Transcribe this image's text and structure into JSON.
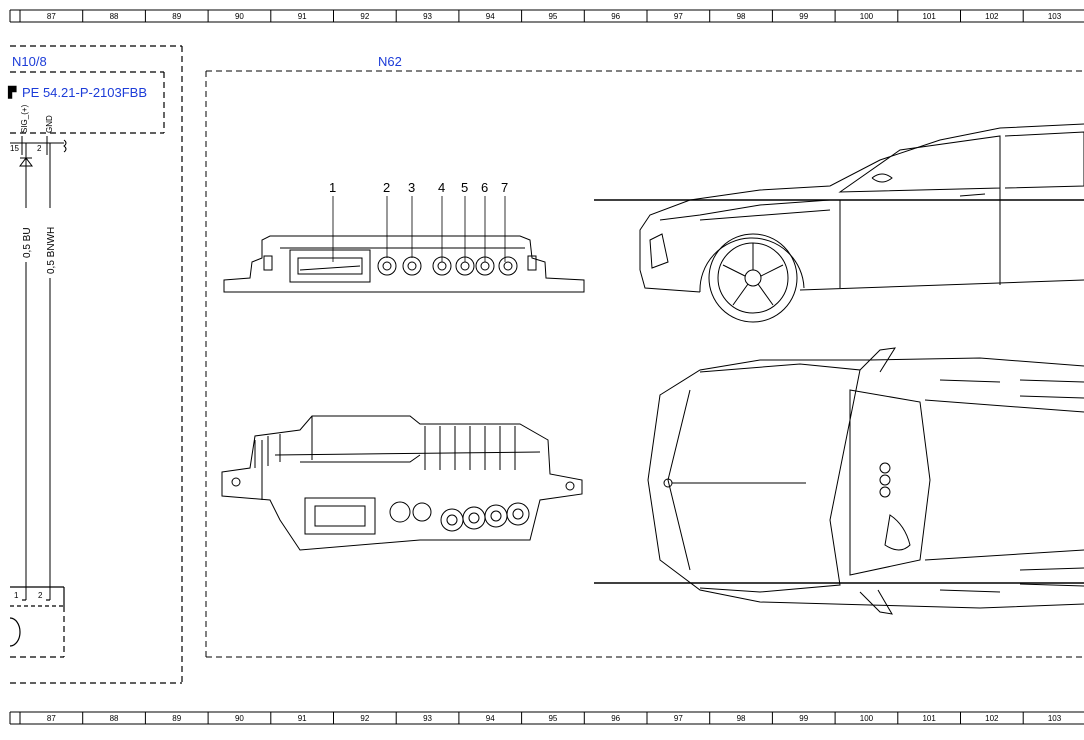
{
  "ruler": {
    "numbers": [
      "87",
      "88",
      "89",
      "90",
      "91",
      "92",
      "93",
      "94",
      "95",
      "96",
      "97",
      "98",
      "99",
      "100",
      "101",
      "102",
      "103"
    ]
  },
  "n10": {
    "label": "N10/8",
    "ref": "PE 54.21-P-2103FBB",
    "pin1_signal": "SIG_(+)",
    "pin2_signal": "GND",
    "pin1_num": "15",
    "pin2_num": "2"
  },
  "wires": [
    {
      "label": "0,5 BU"
    },
    {
      "label": "0,5 BNWH"
    }
  ],
  "bottom_connector": {
    "pin1": "1",
    "pin2": "2"
  },
  "n62": {
    "label": "N62",
    "callouts": [
      "1",
      "2",
      "3",
      "4",
      "5",
      "6",
      "7"
    ]
  },
  "colors": {
    "component_label": "#1c3cd8",
    "line": "#000000"
  }
}
